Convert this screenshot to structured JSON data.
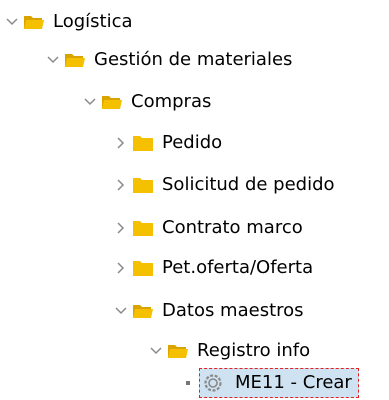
{
  "tree": {
    "nodes": [
      {
        "label": "Logística",
        "state": "expanded",
        "icon": "folder-open-icon"
      },
      {
        "label": "Gestión de materiales",
        "state": "expanded",
        "icon": "folder-open-icon"
      },
      {
        "label": "Compras",
        "state": "expanded",
        "icon": "folder-open-icon"
      },
      {
        "label": "Pedido",
        "state": "collapsed",
        "icon": "folder-closed-icon"
      },
      {
        "label": "Solicitud de pedido",
        "state": "collapsed",
        "icon": "folder-closed-icon"
      },
      {
        "label": "Contrato marco",
        "state": "collapsed",
        "icon": "folder-closed-icon"
      },
      {
        "label": "Pet.oferta/Oferta",
        "state": "collapsed",
        "icon": "folder-closed-icon"
      },
      {
        "label": "Datos maestros",
        "state": "expanded",
        "icon": "folder-open-icon"
      },
      {
        "label": "Registro info",
        "state": "expanded",
        "icon": "folder-open-icon"
      },
      {
        "label": "ME11 - Crear",
        "state": "leaf",
        "icon": "transaction-gear-icon",
        "selected": true
      }
    ]
  },
  "colors": {
    "folder": "#f5c000",
    "folder_dark": "#d9a400",
    "selection_bg": "#cfe2f1",
    "selection_border": "#e22222",
    "chevron": "#8a8a8a"
  }
}
